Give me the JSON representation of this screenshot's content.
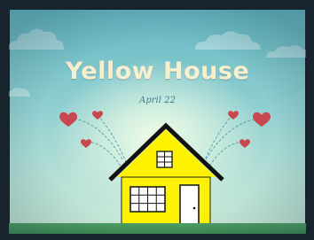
{
  "card": {
    "title": "Yellow House",
    "date": "April 22"
  },
  "colors": {
    "sky_top": "#66b8c3",
    "sky_bottom": "#cdebd8",
    "title": "#f7f0cf",
    "date": "#3c7e94",
    "house": "#fff200",
    "roof": "#111111",
    "heart": "#c9484f",
    "ground": "#4d9f62"
  },
  "icons": [
    "cloud-icon",
    "heart-icon",
    "house-icon",
    "window-icon",
    "door-icon"
  ]
}
